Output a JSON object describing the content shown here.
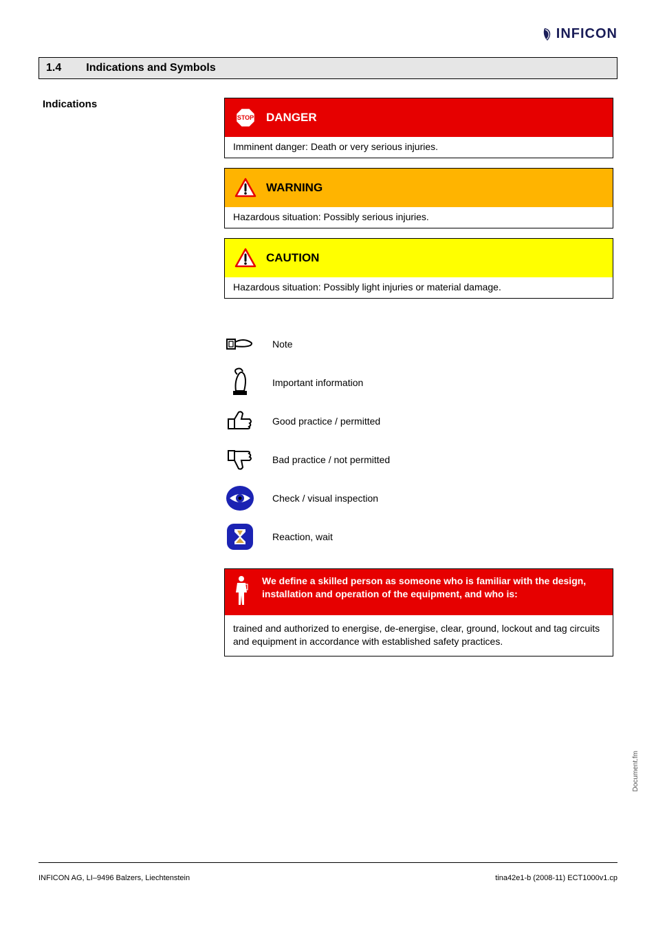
{
  "brand": "INFICON",
  "section": {
    "num": "1.4",
    "title": "Indications and Symbols"
  },
  "sub_label": "Indications",
  "boxes": {
    "danger": {
      "title": "DANGER",
      "text": "Imminent danger: Death or very serious injuries."
    },
    "warning": {
      "title": "WARNING",
      "text": "Hazardous situation: Possibly serious injuries."
    },
    "caution": {
      "title": "CAUTION",
      "text": "Hazardous situation: Possibly light injuries or material damage."
    }
  },
  "symbols": {
    "note": "Note",
    "important": "Important information",
    "good": "Good practice / permitted",
    "bad": "Bad practice / not permitted",
    "check": "Check / visual inspection",
    "wait": "Reaction, wait"
  },
  "skillbox": {
    "head": "We define a skilled person as someone who is familiar with the design, installation and operation of the equipment, and who is:",
    "body": "trained and authorized to energise, de-energise, clear, ground, lockout and tag circuits and equipment in accordance with established safety practices."
  },
  "footer": {
    "left": "INFICON AG, LI–9496 Balzers, Liechtenstein",
    "right": "tina42e1-b   (2008-11)   ECT1000v1.cp"
  },
  "rot": "Document.fm"
}
